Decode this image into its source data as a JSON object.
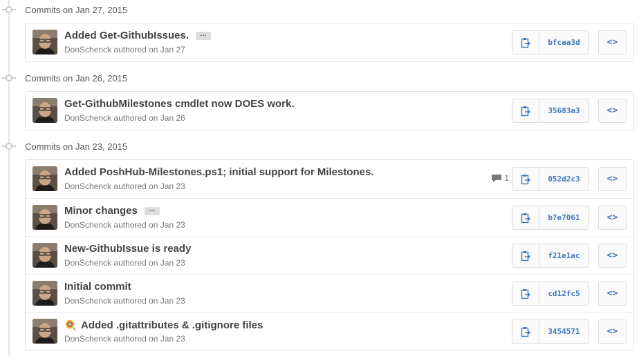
{
  "groups": [
    {
      "title": "Commits on Jan 27, 2015",
      "commits": [
        {
          "message": "Added Get-GithubIssues.",
          "has_ellipsis": true,
          "author": "DonSchenck",
          "authored": "authored on Jan 27",
          "sha": "bfcaa3d",
          "comments": ""
        }
      ]
    },
    {
      "title": "Commits on Jan 26, 2015",
      "commits": [
        {
          "message": "Get-GithubMilestones cmdlet now DOES work.",
          "has_ellipsis": false,
          "author": "DonSchenck",
          "authored": "authored on Jan 26",
          "sha": "35683a3",
          "comments": ""
        }
      ]
    },
    {
      "title": "Commits on Jan 23, 2015",
      "commits": [
        {
          "message": "Added PoshHub-Milestones.ps1; initial support for Milestones.",
          "has_ellipsis": false,
          "author": "DonSchenck",
          "authored": "authored on Jan 23",
          "sha": "052d2c3",
          "comments": "1"
        },
        {
          "message": "Minor changes",
          "has_ellipsis": true,
          "author": "DonSchenck",
          "authored": "authored on Jan 23",
          "sha": "b7e7061",
          "comments": ""
        },
        {
          "message": "New-GithubIssue is ready",
          "has_ellipsis": false,
          "author": "DonSchenck",
          "authored": "authored on Jan 23",
          "sha": "f21e1ac",
          "comments": ""
        },
        {
          "message": "Initial commit",
          "has_ellipsis": false,
          "author": "DonSchenck",
          "authored": "authored on Jan 23",
          "sha": "cd12fc5",
          "comments": ""
        },
        {
          "message": "Added .gitattributes & .gitignore files",
          "has_ellipsis": false,
          "has_emoji": true,
          "emoji_icon": "lollipop-icon",
          "author": "DonSchenck",
          "authored": "authored on Jan 23",
          "sha": "3454571",
          "comments": ""
        }
      ]
    }
  ],
  "icons": {
    "timeline_dot": "git-commit-icon",
    "clipboard": "clipboard-icon",
    "browse": "code-icon",
    "comment": "comment-icon"
  },
  "labels": {
    "ellipsis": "…",
    "browse": "<>"
  },
  "colors": {
    "sha_link": "#4078c0",
    "border": "#e1e1e1"
  }
}
